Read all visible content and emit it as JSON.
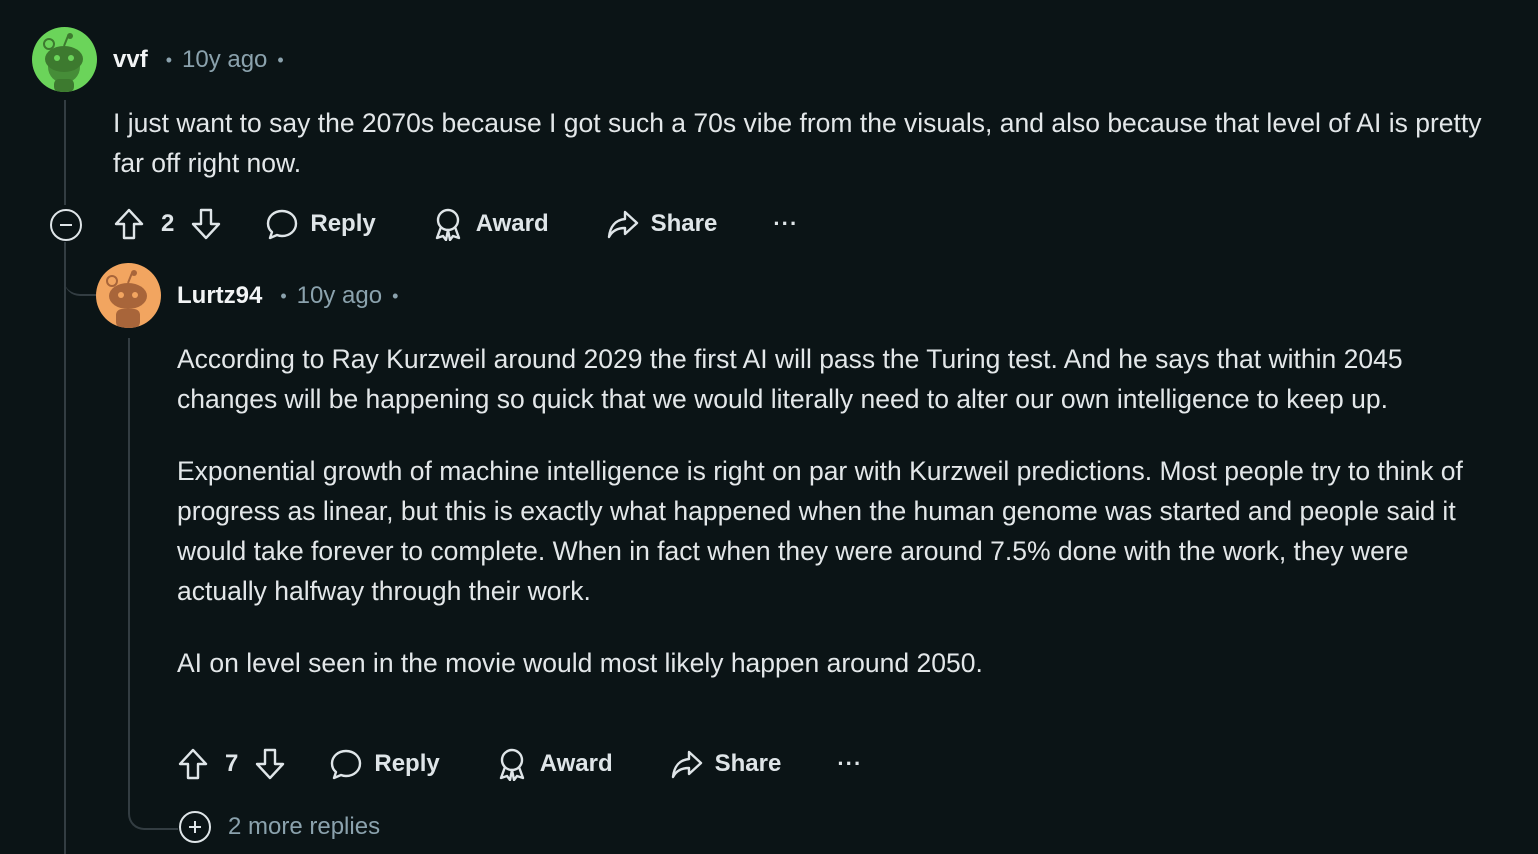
{
  "comments": [
    {
      "username": "vvf",
      "time": "10y ago",
      "avatar_color": "#6bd45a",
      "body": [
        "I just want to say the 2070s because I got such a 70s vibe from the visuals, and also because that level of AI is pretty far off right now."
      ],
      "votes": "2",
      "reply_label": "Reply",
      "award_label": "Award",
      "share_label": "Share",
      "more_label": "···"
    },
    {
      "username": "Lurtz94",
      "time": "10y ago",
      "avatar_color": "#f2a560",
      "body": [
        "According to Ray Kurzweil around 2029 the first AI will pass the Turing test. And he says that within 2045 changes will be happening so quick that we would literally need to alter our own intelligence to keep up.",
        "Exponential growth of machine intelligence is right on par with Kurzweil predictions. Most people try to think of progress as linear, but this is exactly what happened when the human genome was started and people said it would take forever to complete. When in fact when they were around 7.5% done with the work, they were actually halfway through their work.",
        "AI on level seen in the movie would most likely happen around 2050."
      ],
      "votes": "7",
      "reply_label": "Reply",
      "award_label": "Award",
      "share_label": "Share",
      "more_label": "···"
    }
  ],
  "more_replies": "2 more replies",
  "separator": "•"
}
